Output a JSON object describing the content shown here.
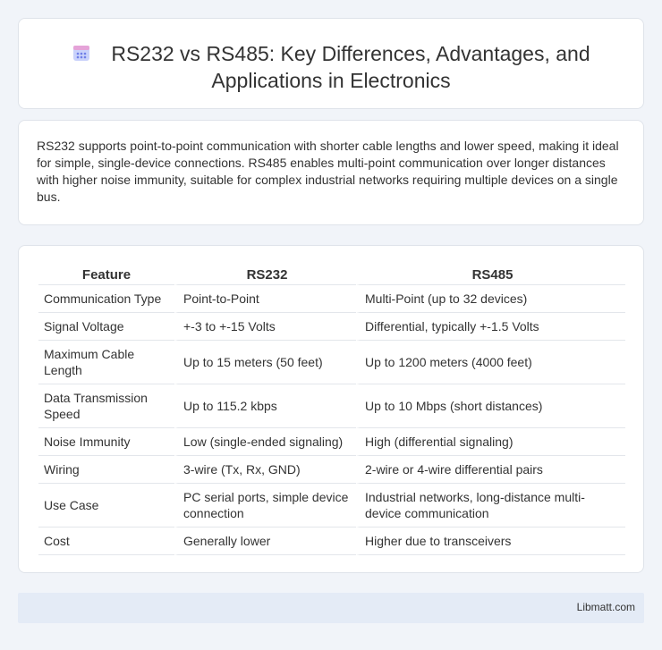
{
  "header": {
    "icon": "calendar-icon",
    "title": "RS232 vs RS485: Key Differences, Advantages, and Applications in Electronics"
  },
  "summary": {
    "text": "RS232 supports point-to-point communication with shorter cable lengths and lower speed, making it ideal for simple, single-device connections. RS485 enables multi-point communication over longer distances with higher noise immunity, suitable for complex industrial networks requiring multiple devices on a single bus."
  },
  "table": {
    "headers": [
      "Feature",
      "RS232",
      "RS485"
    ],
    "rows": [
      [
        "Communication Type",
        "Point-to-Point",
        "Multi-Point (up to 32 devices)"
      ],
      [
        "Signal Voltage",
        "+-3 to +-15 Volts",
        "Differential, typically +-1.5 Volts"
      ],
      [
        "Maximum Cable Length",
        "Up to 15 meters (50 feet)",
        "Up to 1200 meters (4000 feet)"
      ],
      [
        "Data Transmission Speed",
        "Up to 115.2 kbps",
        "Up to 10 Mbps (short distances)"
      ],
      [
        "Noise Immunity",
        "Low (single-ended signaling)",
        "High (differential signaling)"
      ],
      [
        "Wiring",
        "3-wire (Tx, Rx, GND)",
        "2-wire or 4-wire differential pairs"
      ],
      [
        "Use Case",
        "PC serial ports, simple device connection",
        "Industrial networks, long-distance multi-device communication"
      ],
      [
        "Cost",
        "Generally lower",
        "Higher due to transceivers"
      ]
    ]
  },
  "footer": {
    "text": "Libmatt.com"
  },
  "colors": {
    "background": "#f1f4f9",
    "card": "#ffffff",
    "footer": "#e4ebf6",
    "icon_primary": "#7b8ef0",
    "icon_accent": "#e8a0d6"
  }
}
